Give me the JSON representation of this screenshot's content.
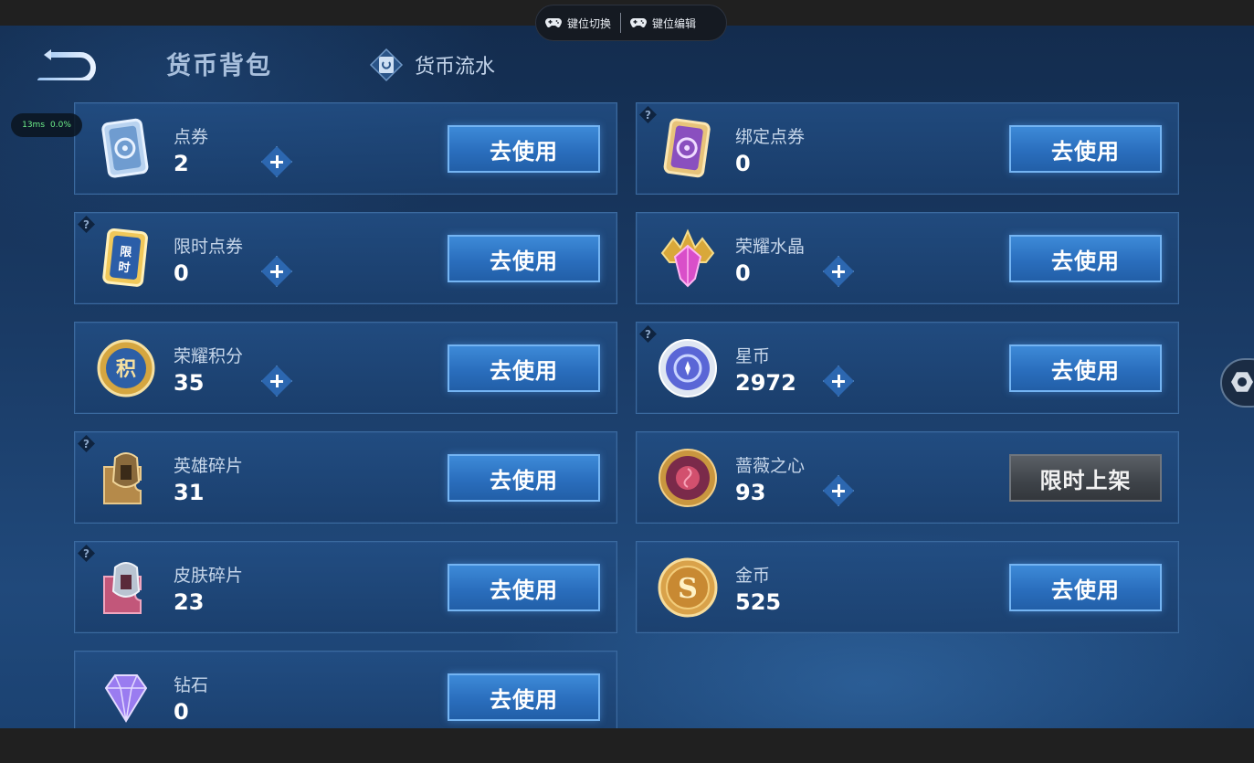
{
  "toolbar": {
    "key_switch": "键位切换",
    "key_edit": "键位编辑"
  },
  "perf": {
    "latency": "13ms",
    "loss": "0.0%"
  },
  "header": {
    "title": "货币背包",
    "flow_tab": "货币流水"
  },
  "currencies": [
    {
      "name": "点券",
      "amount": "2",
      "button": "去使用"
    },
    {
      "name": "绑定点券",
      "amount": "0",
      "button": "去使用"
    },
    {
      "name": "限时点券",
      "amount": "0",
      "button": "去使用"
    },
    {
      "name": "荣耀水晶",
      "amount": "0",
      "button": "去使用"
    },
    {
      "name": "荣耀积分",
      "amount": "35",
      "button": "去使用"
    },
    {
      "name": "星币",
      "amount": "2972",
      "button": "去使用"
    },
    {
      "name": "英雄碎片",
      "amount": "31",
      "button": "去使用"
    },
    {
      "name": "蔷薇之心",
      "amount": "93",
      "button": "限时上架"
    },
    {
      "name": "皮肤碎片",
      "amount": "23",
      "button": "去使用"
    },
    {
      "name": "金币",
      "amount": "525",
      "button": "去使用"
    },
    {
      "name": "钻石",
      "amount": "0",
      "button": "去使用"
    }
  ],
  "icons": {
    "dianjuan": "ticket-card-icon",
    "bangding": "bound-ticket-card-icon",
    "xianshi": "limited-ticket-icon",
    "shuijing": "glory-crystal-icon",
    "jifen": "glory-points-icon",
    "xingbi": "star-coin-icon",
    "yingxiong": "hero-shard-icon",
    "qiangwei": "rose-heart-icon",
    "pifu": "skin-shard-icon",
    "jinbi": "gold-coin-icon",
    "zuanshi": "diamond-icon"
  },
  "colors": {
    "button_blue": "#2a6ebd",
    "button_gray": "#3e4349",
    "card_bg": "#1f4a80",
    "background": "#1a3b66"
  }
}
